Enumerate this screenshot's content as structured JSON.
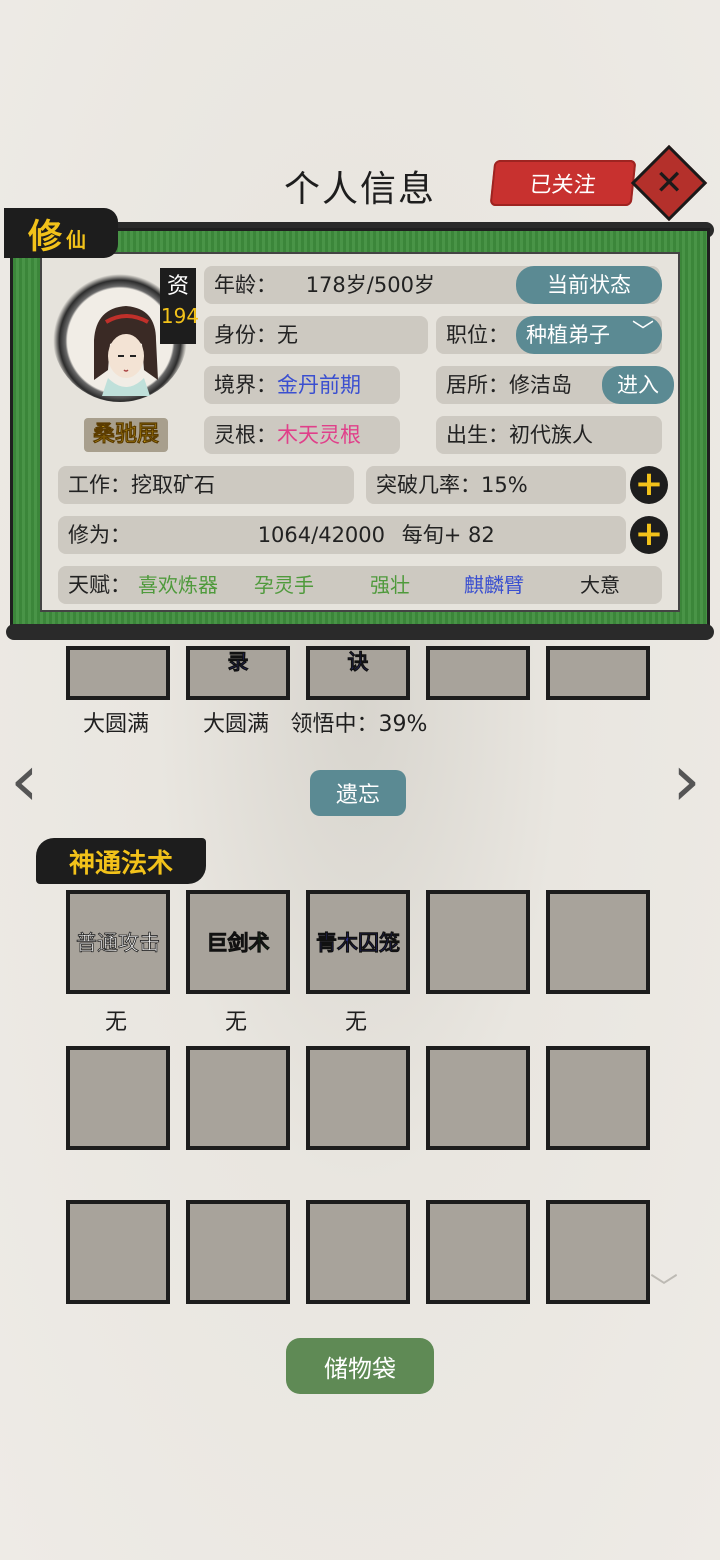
{
  "header": {
    "title": "个人信息",
    "follow_label": "已关注",
    "close_icon": "close-icon"
  },
  "badge": {
    "xiu": "修",
    "xian": "仙"
  },
  "character": {
    "zi_label": "资",
    "zi_value": "194",
    "name": "桑驰展",
    "age_label": "年龄：",
    "age_value": "178岁/500岁",
    "status_button": "当前状态",
    "identity_label": "身份：",
    "identity_value": "无",
    "position_label": "职位：",
    "position_value": "种植弟子",
    "realm_label": "境界：",
    "realm_value": "金丹前期",
    "residence_label": "居所：",
    "residence_value": "修洁岛",
    "enter_button": "进入",
    "root_label": "灵根：",
    "root_value": "木天灵根",
    "birth_label": "出生：",
    "birth_value": "初代族人",
    "work_label": "工作：",
    "work_value": "挖取矿石",
    "breakthrough_label": "突破几率：",
    "breakthrough_value": "15%",
    "cultivation_label": "修为：",
    "cultivation_value": "1064/42000",
    "cultivation_rate": "每旬+ 82",
    "talent_label": "天赋：",
    "talents": [
      "喜欢炼器",
      "孕灵手",
      "强壮",
      "麒麟臂",
      "大意"
    ]
  },
  "techniques": {
    "top_slots": [
      "录",
      "诀"
    ],
    "status": [
      "大圆满",
      "大圆满",
      "领悟中：39%"
    ],
    "forget_button": "遗忘"
  },
  "spells": {
    "section_title": "神通法术",
    "slots": [
      "普通攻击",
      "巨剑术",
      "青木囚笼"
    ],
    "levels": [
      "无",
      "无",
      "无"
    ]
  },
  "footer": {
    "bag_button": "储物袋"
  },
  "colors": {
    "accent_red": "#c8312f",
    "scroll_green": "#3f8e3d",
    "teal": "#5b8a93",
    "gold": "#f2c21a"
  }
}
